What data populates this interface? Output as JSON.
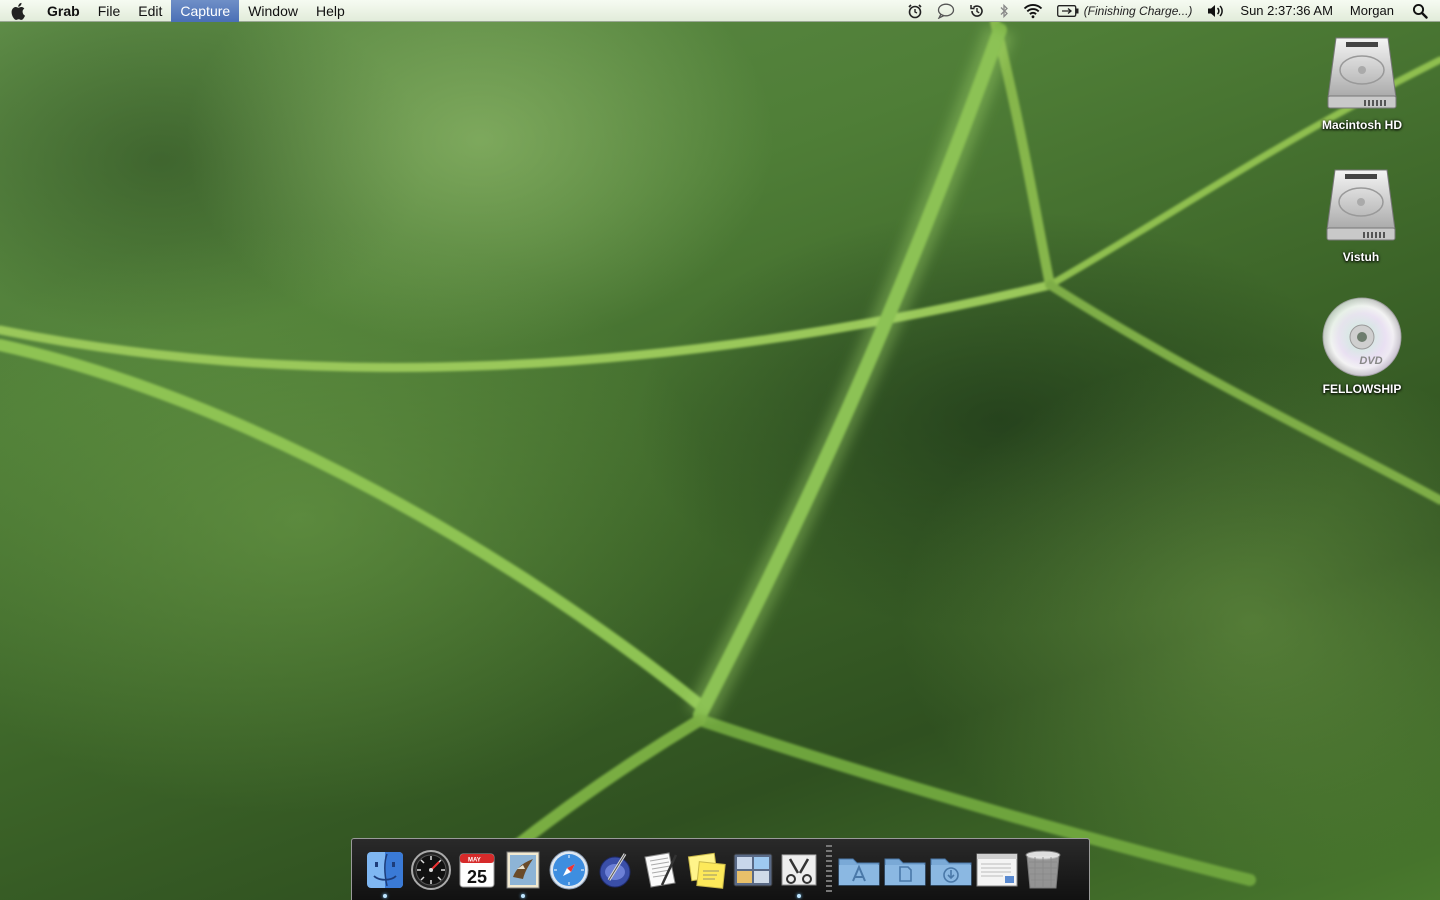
{
  "menubar": {
    "app_name": "Grab",
    "menus": [
      "File",
      "Edit",
      "Capture",
      "Window",
      "Help"
    ],
    "active_menu": "Capture",
    "status_icons": [
      "alarm-icon",
      "chat-bubble-icon",
      "time-machine-icon",
      "bluetooth-icon",
      "wifi-icon",
      "battery-icon",
      "volume-icon"
    ],
    "battery_text": "(Finishing Charge...)",
    "clock": "Sun 2:37:36 AM",
    "user": "Morgan"
  },
  "desktop": {
    "icons": [
      {
        "label": "Macintosh HD",
        "type": "hard-drive"
      },
      {
        "label": "Vistuh",
        "type": "hard-drive"
      },
      {
        "label": "FELLOWSHIP",
        "type": "dvd"
      }
    ]
  },
  "dock": {
    "apps": [
      {
        "name": "finder-icon",
        "running": true
      },
      {
        "name": "dashboard-icon",
        "running": false
      },
      {
        "name": "ical-icon",
        "running": false,
        "calendar_month": "MAY",
        "calendar_day": "25"
      },
      {
        "name": "mail-icon",
        "running": true
      },
      {
        "name": "safari-icon",
        "running": false
      },
      {
        "name": "ichat-icon",
        "running": false
      },
      {
        "name": "textedit-icon",
        "running": false
      },
      {
        "name": "stickies-icon",
        "running": false
      },
      {
        "name": "spaces-icon",
        "running": false
      },
      {
        "name": "grab-icon",
        "running": true
      }
    ],
    "stacks": [
      {
        "name": "applications-folder-icon"
      },
      {
        "name": "documents-folder-icon"
      },
      {
        "name": "downloads-folder-icon"
      },
      {
        "name": "window-preview-icon"
      },
      {
        "name": "trash-icon"
      }
    ]
  },
  "colors": {
    "menubar_active": "#4a6fb5",
    "dock_bg": "#1a1a1a",
    "wallpaper_base": "#3f6a2c"
  }
}
